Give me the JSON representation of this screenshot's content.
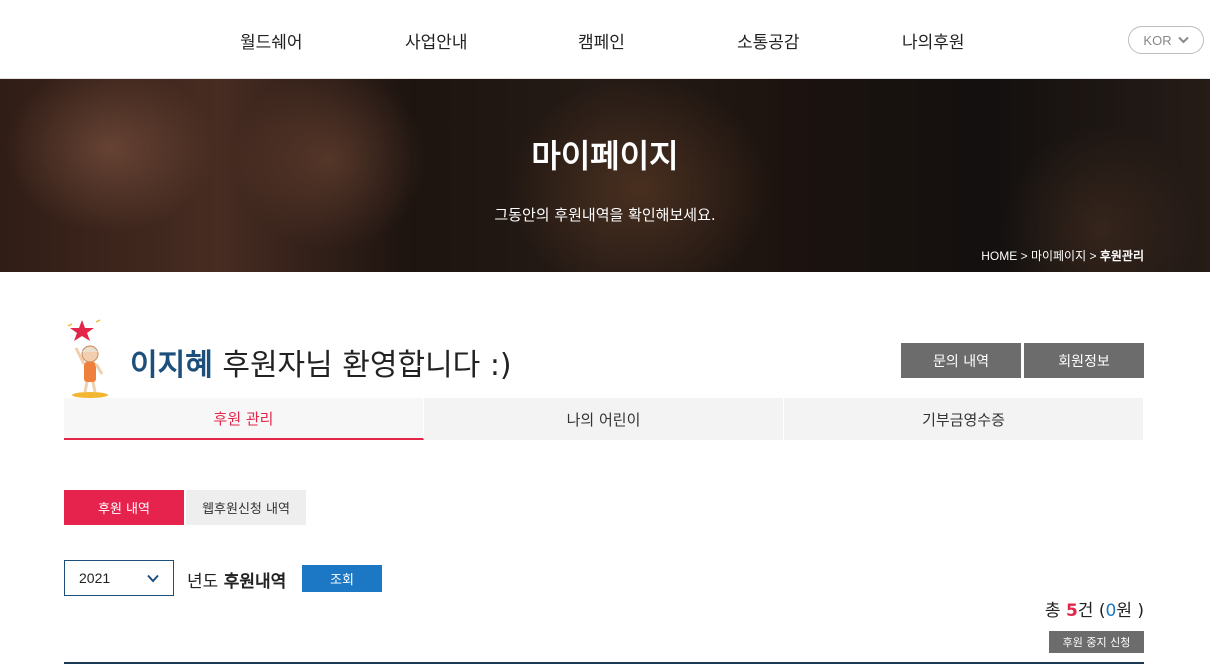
{
  "nav": {
    "items": [
      "월드쉐어",
      "사업안내",
      "캠페인",
      "소통공감",
      "나의후원"
    ],
    "lang": "KOR"
  },
  "hero": {
    "title": "마이페이지",
    "subtitle": "그동안의 후원내역을 확인해보세요.",
    "breadcrumb_home": "HOME",
    "breadcrumb_sep": " > ",
    "breadcrumb_mid": "마이페이지",
    "breadcrumb_current": "후원관리"
  },
  "welcome": {
    "name": "이지혜",
    "message": " 후원자님 환영합니다 :)",
    "btn_inquiry": "문의 내역",
    "btn_member": "회원정보"
  },
  "tabs": [
    "후원 관리",
    "나의 어린이",
    "기부금영수증"
  ],
  "subtabs": [
    "후원 내역",
    "웹후원신청 내역"
  ],
  "filter": {
    "year": "2021",
    "label_prefix": "년도 ",
    "label_bold": "후원내역",
    "search_btn": "조회"
  },
  "summary": {
    "prefix": "총 ",
    "count": "5",
    "count_unit": "건 (",
    "amount": "0",
    "amount_unit": "원 )"
  },
  "stop_btn": "후원 중지 신청",
  "colors": {
    "accent_red": "#e3254a",
    "accent_blue": "#1c78c4",
    "navy": "#1d4f7c"
  }
}
